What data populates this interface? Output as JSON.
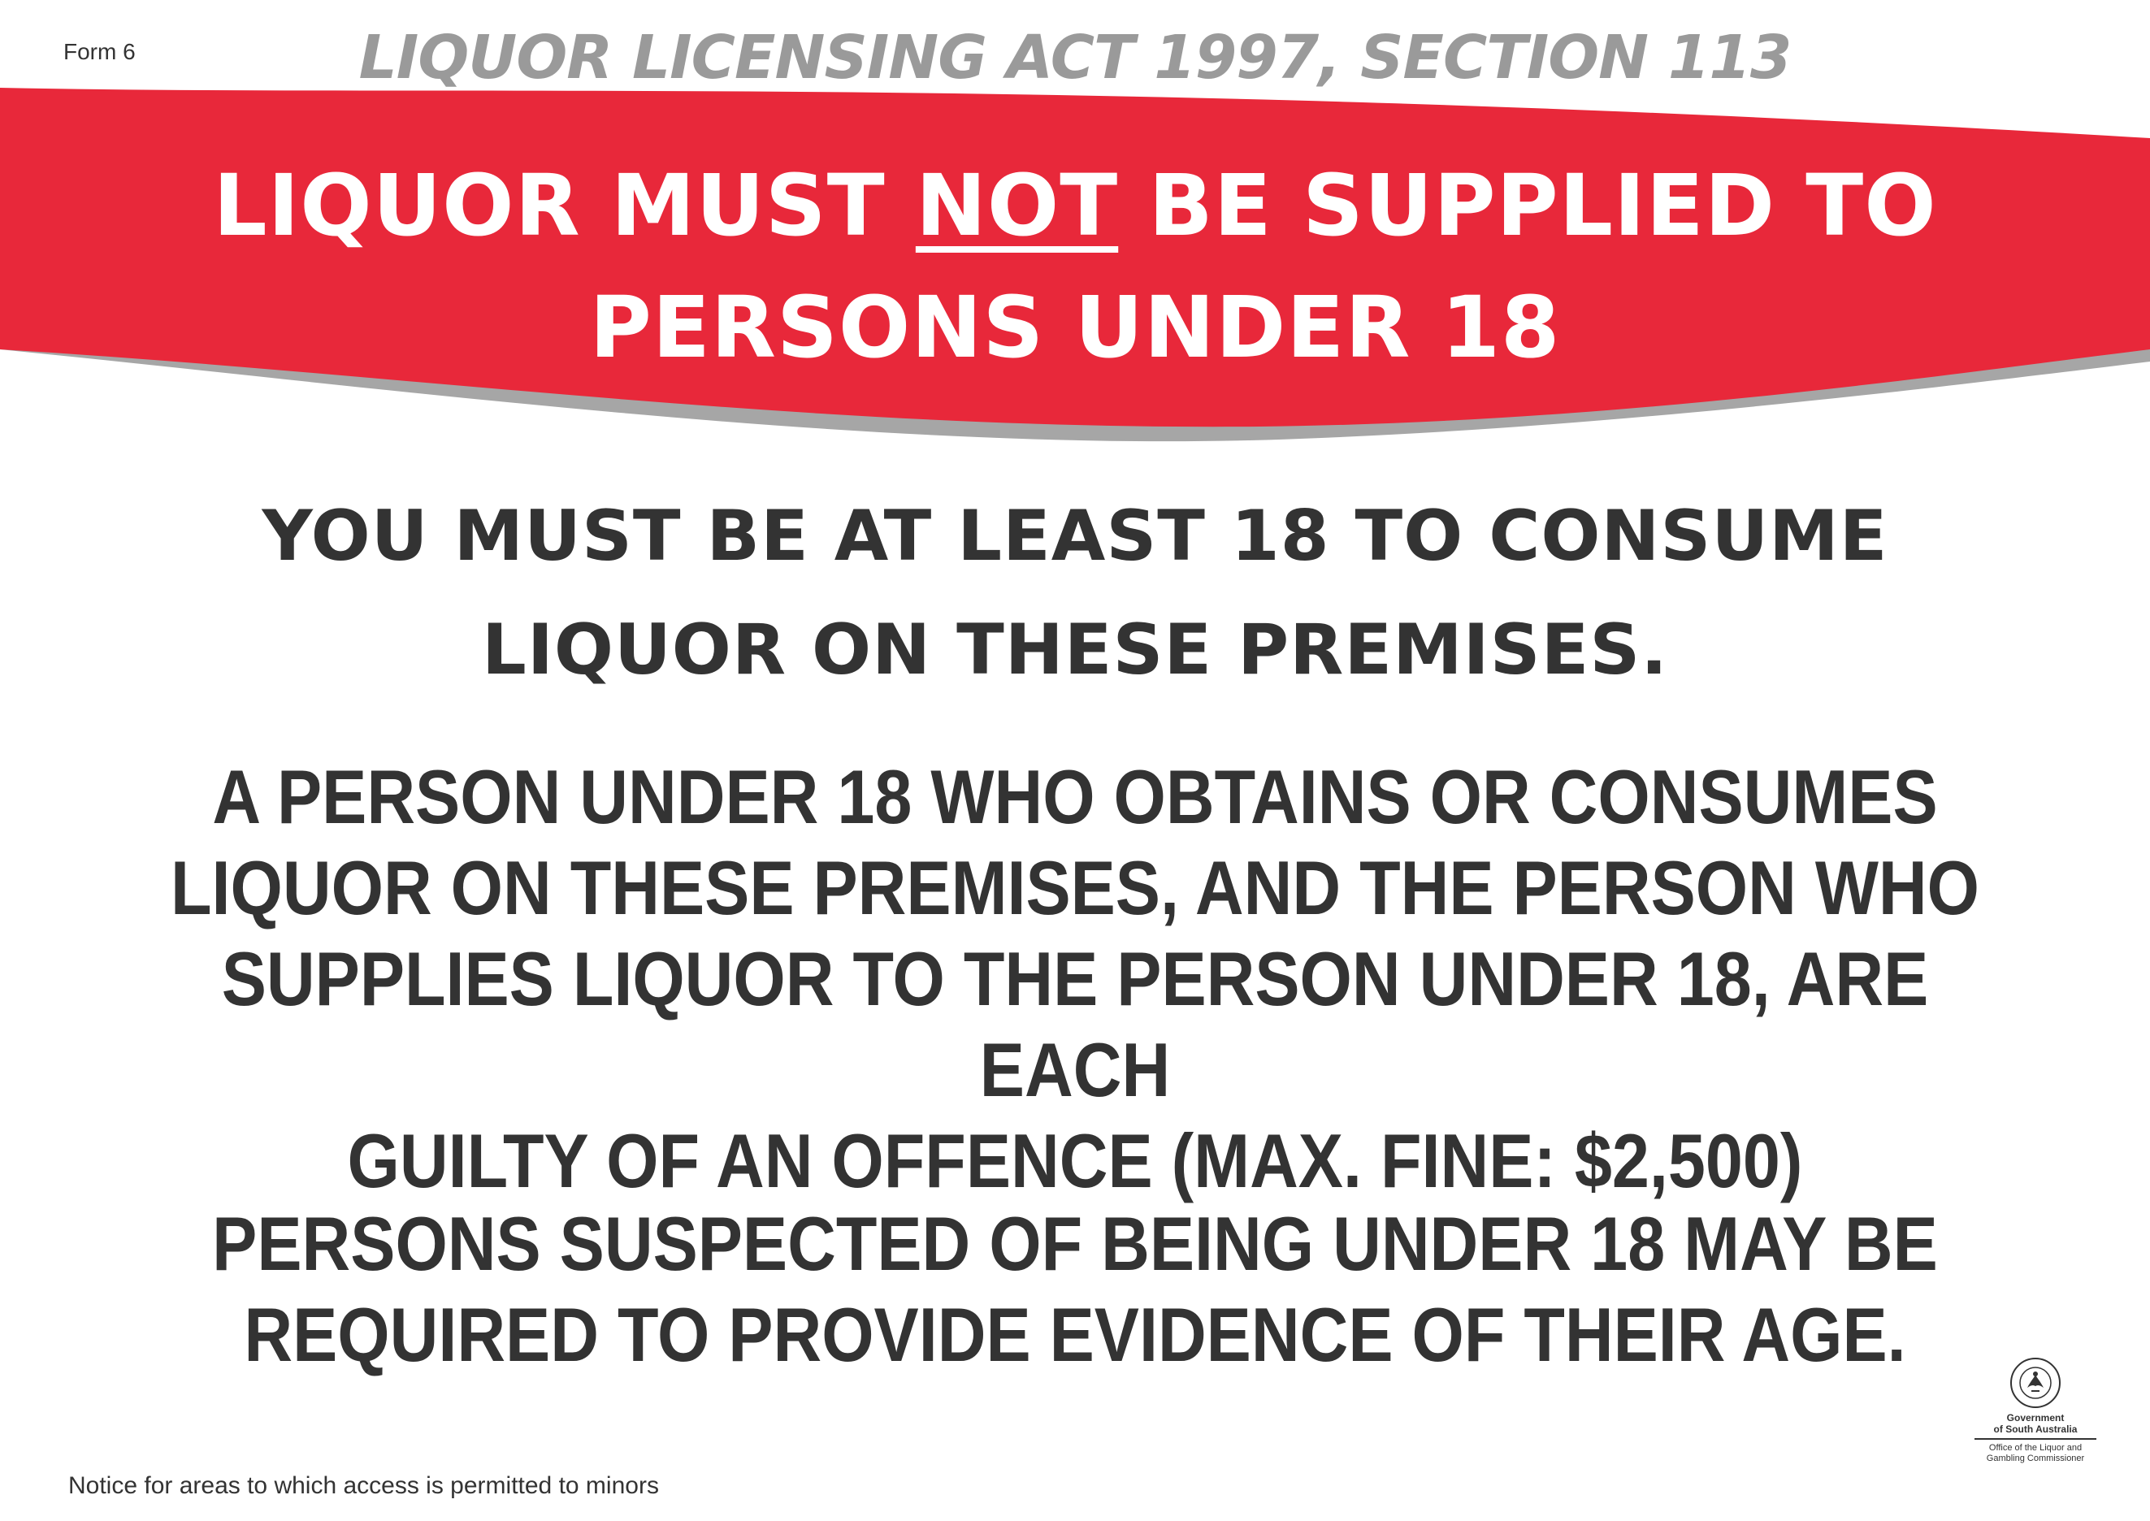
{
  "form_label": "Form 6",
  "act_title": "LIQUOR LICENSING ACT 1997, SECTION 113",
  "banner": {
    "line1_before": "LIQUOR MUST ",
    "line1_emphasis": "NOT",
    "line1_after": " BE SUPPLIED TO",
    "line2": "PERSONS UNDER 18",
    "color_red": "#e8283a",
    "color_grey": "#a6a6a6"
  },
  "notice_heading": {
    "line1": "YOU MUST BE AT LEAST 18 TO CONSUME",
    "line2": "LIQUOR ON THESE PREMISES."
  },
  "offence_notice": {
    "line1": "A PERSON UNDER 18 WHO OBTAINS OR CONSUMES",
    "line2": "LIQUOR ON THESE PREMISES, AND THE PERSON WHO",
    "line3": "SUPPLIES LIQUOR TO THE PERSON UNDER 18, ARE EACH",
    "line4": "GUILTY OF AN OFFENCE (MAX. FINE: $2,500)"
  },
  "evidence_notice": {
    "line1": "PERSONS SUSPECTED OF BEING UNDER 18 MAY BE",
    "line2": "REQUIRED TO PROVIDE EVIDENCE OF THEIR AGE."
  },
  "footer_notice": "Notice for areas to which access is permitted to minors",
  "government_logo": {
    "crest_text": "SOUTH AUSTRALIA",
    "icon": "piping-shrike-crest-icon",
    "name_line1": "Government",
    "name_line2": "of South Australia",
    "office_line1": "Office of the Liquor and",
    "office_line2": "Gambling Commissioner"
  }
}
